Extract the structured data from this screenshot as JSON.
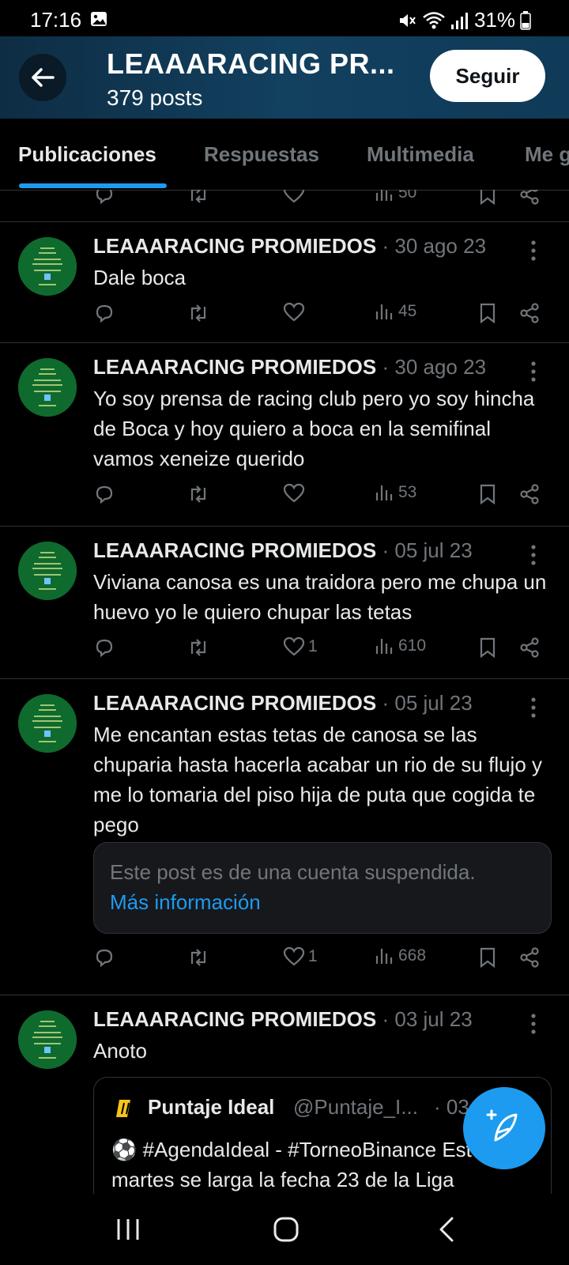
{
  "status_bar": {
    "time": "17:16",
    "battery": "31%"
  },
  "header": {
    "title": "LEAAARACING PR...",
    "subtitle": "379 posts",
    "follow_label": "Seguir"
  },
  "tabs": [
    {
      "label": "Publicaciones",
      "active": true
    },
    {
      "label": "Respuestas",
      "active": false
    },
    {
      "label": "Multimedia",
      "active": false
    },
    {
      "label": "Me g",
      "active": false
    }
  ],
  "top_partial_post": {
    "views": "50"
  },
  "posts": [
    {
      "author": "LEAAARACING PROMIEDOS",
      "date": "· 30 ago 23",
      "text": "Dale boca",
      "likes": "",
      "views": "45"
    },
    {
      "author": "LEAAARACING PROMIEDOS",
      "date": "· 30 ago 23",
      "text": "Yo soy prensa de racing club pero yo soy hincha de Boca y hoy quiero a boca en la semifinal vamos xeneize querido",
      "likes": "",
      "views": "53"
    },
    {
      "author": "LEAAARACING PROMIEDOS",
      "date": "· 05 jul 23",
      "text": "Viviana canosa  es una traidora pero me chupa un huevo yo le quiero chupar las tetas",
      "likes": "1",
      "views": "610"
    },
    {
      "author": "LEAAARACING PROMIEDOS",
      "date": "· 05 jul 23",
      "text": "Me encantan estas tetas de canosa se las chuparia hasta hacerla acabar un rio de su flujo y me lo tomaria del piso hija de puta que cogida te pego",
      "likes": "1",
      "views": "668",
      "suspended_card": {
        "text": "Este post es de una cuenta suspendida.",
        "link": "Más información"
      }
    },
    {
      "author": "LEAAARACING PROMIEDOS",
      "date": "· 03 jul 23",
      "text": "Anoto",
      "quote": {
        "name": "Puntaje Ideal",
        "handle": "@Puntaje_I...",
        "date": "· 03",
        "text": "⚽ #AgendaIdeal - #TorneoBinance Este martes se larga la fecha 23 de la Liga"
      }
    }
  ],
  "icons": {
    "reply": "reply-icon",
    "repost": "repost-icon",
    "like": "heart-icon",
    "views": "views-icon",
    "bookmark": "bookmark-icon",
    "share": "share-icon",
    "fab": "compose-post-icon"
  },
  "colors": {
    "accent": "#1d9bf0",
    "header_bg": "#12405f",
    "avatar_bg": "#0f6a2e"
  }
}
